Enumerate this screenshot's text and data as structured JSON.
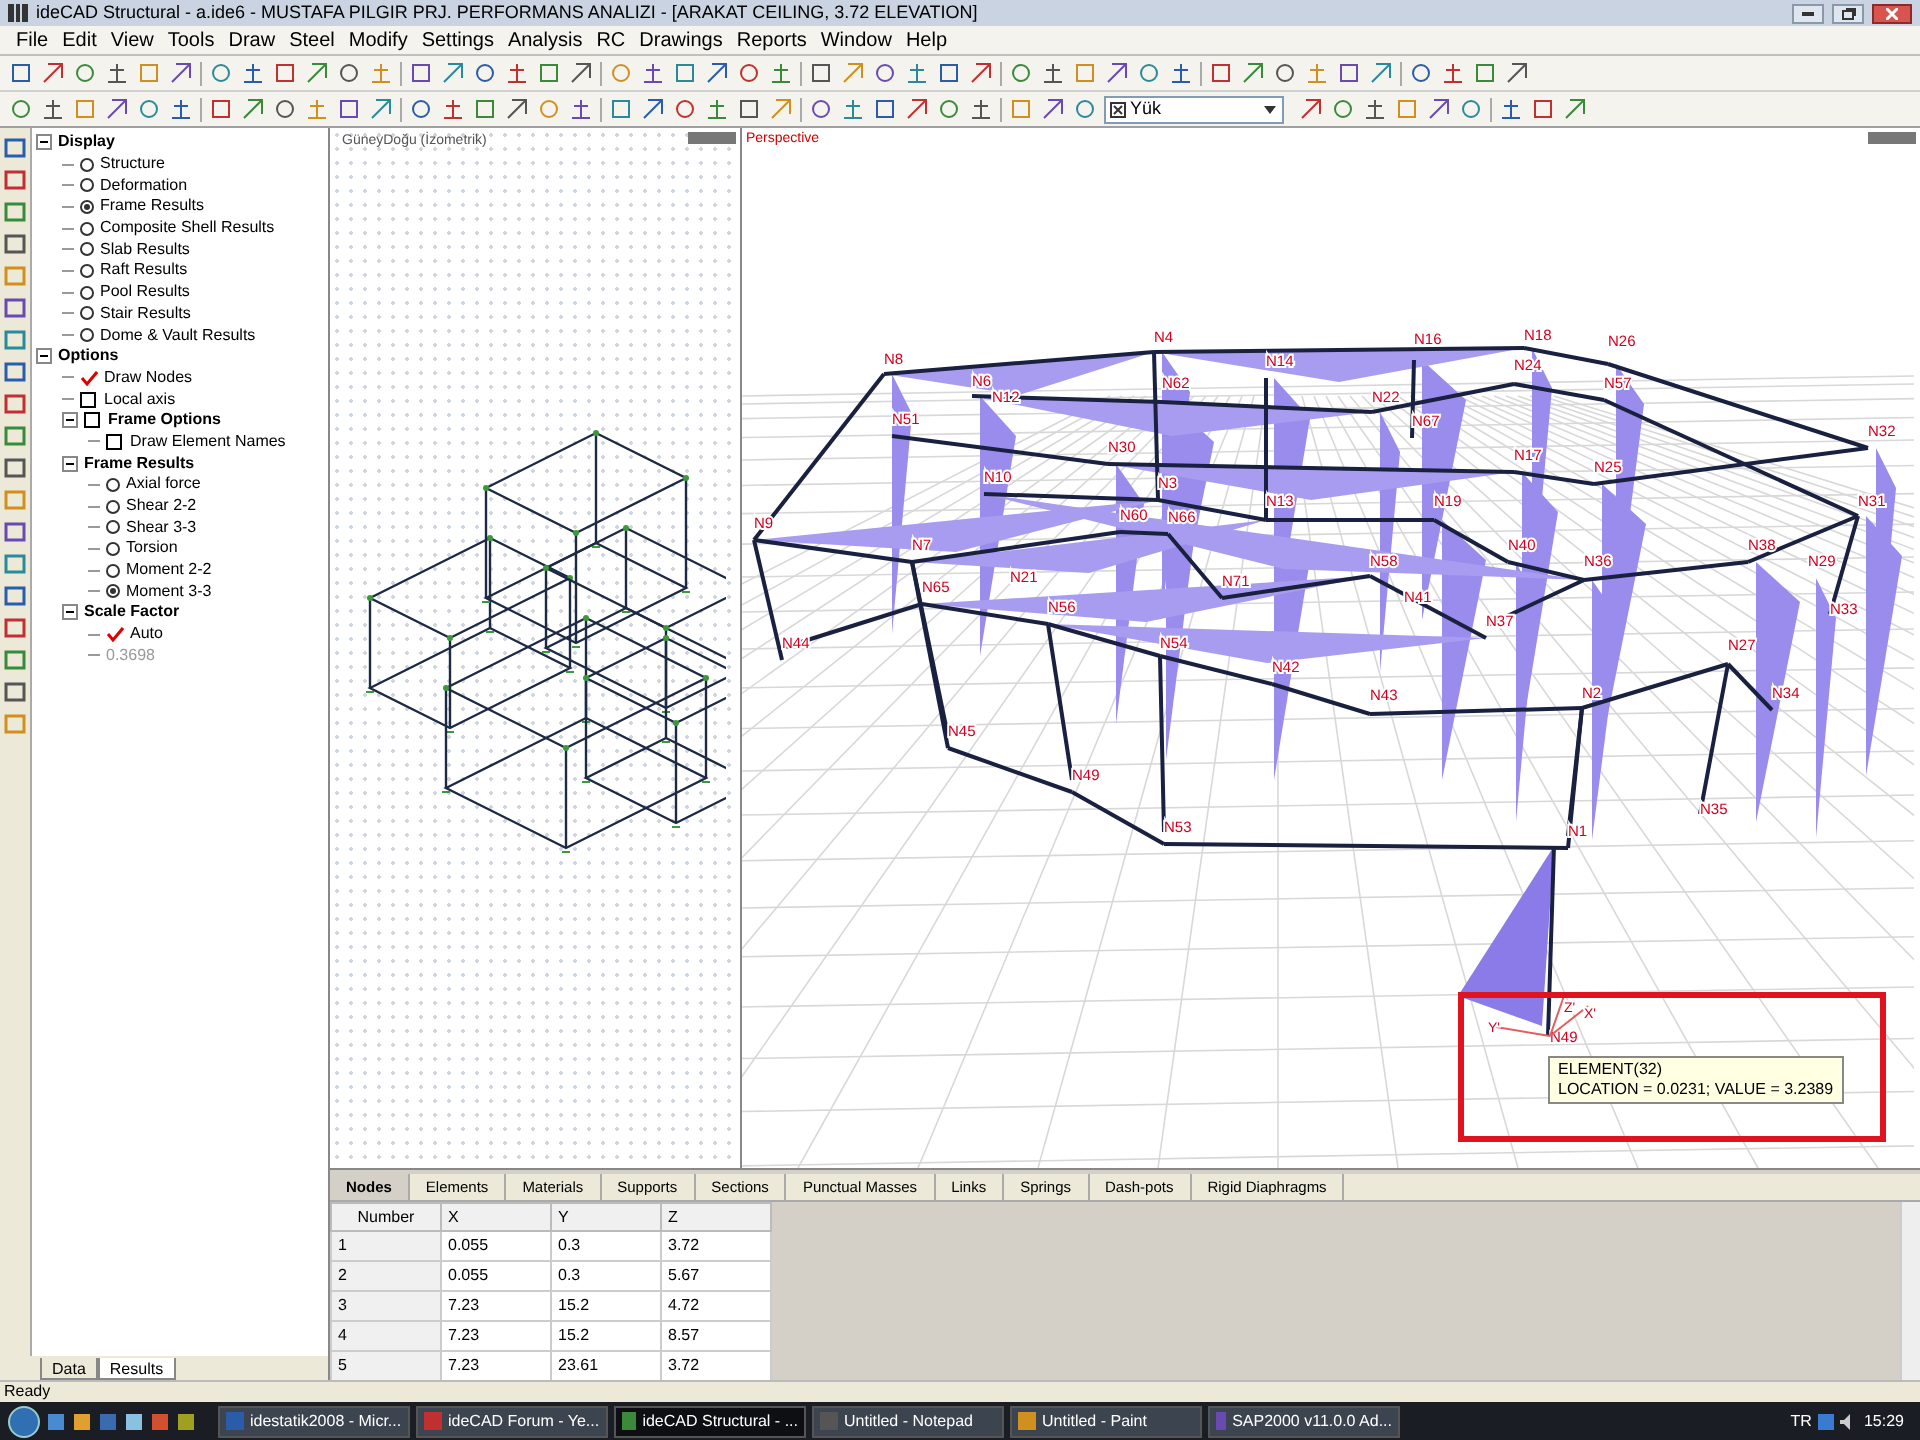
{
  "window": {
    "title": "ideCAD Structural - a.ide6 - MUSTAFA PILGIR PRJ. PERFORMANS ANALIZI - [ARAKAT CEILING,  3.72 ELEVATION]"
  },
  "menu": [
    "File",
    "Edit",
    "View",
    "Tools",
    "Draw",
    "Steel",
    "Modify",
    "Settings",
    "Analysis",
    "RC",
    "Drawings",
    "Reports",
    "Window",
    "Help"
  ],
  "toolbar": {
    "load_case": "Yük"
  },
  "tree": [
    {
      "label": "Display",
      "kind": "group",
      "expanded": true,
      "children": [
        {
          "label": "Structure",
          "kind": "radio",
          "selected": false
        },
        {
          "label": "Deformation",
          "kind": "radio",
          "selected": false
        },
        {
          "label": "Frame Results",
          "kind": "radio",
          "selected": true
        },
        {
          "label": "Composite Shell Results",
          "kind": "radio",
          "selected": false
        },
        {
          "label": "Slab Results",
          "kind": "radio",
          "selected": false
        },
        {
          "label": "Raft Results",
          "kind": "radio",
          "selected": false
        },
        {
          "label": "Pool Results",
          "kind": "radio",
          "selected": false
        },
        {
          "label": "Stair Results",
          "kind": "radio",
          "selected": false
        },
        {
          "label": "Dome & Vault Results",
          "kind": "radio",
          "selected": false
        }
      ]
    },
    {
      "label": "Options",
      "kind": "group",
      "expanded": true,
      "children": [
        {
          "label": "Draw Nodes",
          "kind": "check",
          "checked": true
        },
        {
          "label": "Local axis",
          "kind": "check",
          "checked": false
        },
        {
          "label": "Frame Options",
          "kind": "check",
          "checked": false,
          "expanded": true,
          "children": [
            {
              "label": "Draw Element Names",
              "kind": "check",
              "checked": false
            }
          ]
        },
        {
          "label": "Frame Results",
          "kind": "group",
          "expanded": true,
          "children": [
            {
              "label": "Axial force",
              "kind": "radio",
              "selected": false
            },
            {
              "label": "Shear 2-2",
              "kind": "radio",
              "selected": false
            },
            {
              "label": "Shear 3-3",
              "kind": "radio",
              "selected": false
            },
            {
              "label": "Torsion",
              "kind": "radio",
              "selected": false
            },
            {
              "label": "Moment 2-2",
              "kind": "radio",
              "selected": false
            },
            {
              "label": "Moment 3-3",
              "kind": "radio",
              "selected": true
            }
          ]
        },
        {
          "label": "Scale Factor",
          "kind": "group",
          "expanded": true,
          "children": [
            {
              "label": "Auto",
              "kind": "check",
              "checked": true
            },
            {
              "label": "0.3698",
              "kind": "value",
              "disabled": true
            }
          ]
        }
      ]
    }
  ],
  "left_tabs": [
    {
      "label": "Data",
      "selected": false
    },
    {
      "label": "Results",
      "selected": true
    }
  ],
  "iso_view": {
    "title": "GüneyDoğu (İzometrik)"
  },
  "perspective_view": {
    "title": "Perspective",
    "nodes": [
      "N4",
      "N16",
      "N18",
      "N26",
      "N8",
      "N14",
      "N24",
      "N6",
      "N62",
      "N57",
      "N12",
      "N22",
      "N51",
      "N67",
      "N32",
      "N30",
      "N17",
      "N25",
      "N10",
      "N3",
      "N13",
      "N19",
      "N31",
      "N60",
      "N66",
      "N9",
      "N7",
      "N40",
      "N38",
      "N58",
      "N36",
      "N29",
      "N21",
      "N71",
      "N65",
      "N41",
      "N56",
      "N33",
      "N37",
      "N44",
      "N54",
      "N27",
      "N42",
      "N43",
      "N2",
      "N34",
      "N45",
      "N49",
      "N35",
      "N53",
      "N1",
      "N49"
    ],
    "axes": [
      "Z'",
      "X'",
      "Y'"
    ],
    "tooltip": [
      "ELEMENT(32)",
      "LOCATION = 0.0231; VALUE = 3.2389"
    ]
  },
  "table": {
    "tabs": [
      {
        "label": "Nodes",
        "selected": true
      },
      {
        "label": "Elements",
        "selected": false
      },
      {
        "label": "Materials",
        "selected": false
      },
      {
        "label": "Supports",
        "selected": false
      },
      {
        "label": "Sections",
        "selected": false
      },
      {
        "label": "Punctual Masses",
        "selected": false
      },
      {
        "label": "Links",
        "selected": false
      },
      {
        "label": "Springs",
        "selected": false
      },
      {
        "label": "Dash-pots",
        "selected": false
      },
      {
        "label": "Rigid Diaphragms",
        "selected": false
      }
    ],
    "columns": [
      "Number",
      "X",
      "Y",
      "Z"
    ],
    "rows": [
      [
        "1",
        "0.055",
        "0.3",
        "3.72"
      ],
      [
        "2",
        "0.055",
        "0.3",
        "5.67"
      ],
      [
        "3",
        "7.23",
        "15.2",
        "4.72"
      ],
      [
        "4",
        "7.23",
        "15.2",
        "8.57"
      ],
      [
        "5",
        "7.23",
        "23.61",
        "3.72"
      ]
    ]
  },
  "status_bar": "Ready",
  "taskbar": {
    "items": [
      {
        "label": "idestatik2008 - Micr...",
        "selected": false
      },
      {
        "label": "ideCAD Forum - Ye...",
        "selected": false
      },
      {
        "label": "ideCAD Structural - ...",
        "selected": true
      },
      {
        "label": "Untitled - Notepad",
        "selected": false
      },
      {
        "label": "Untitled - Paint",
        "selected": false
      },
      {
        "label": "SAP2000 v11.0.0 Ad...",
        "selected": false
      }
    ],
    "language": "TR",
    "clock": "15:29"
  }
}
